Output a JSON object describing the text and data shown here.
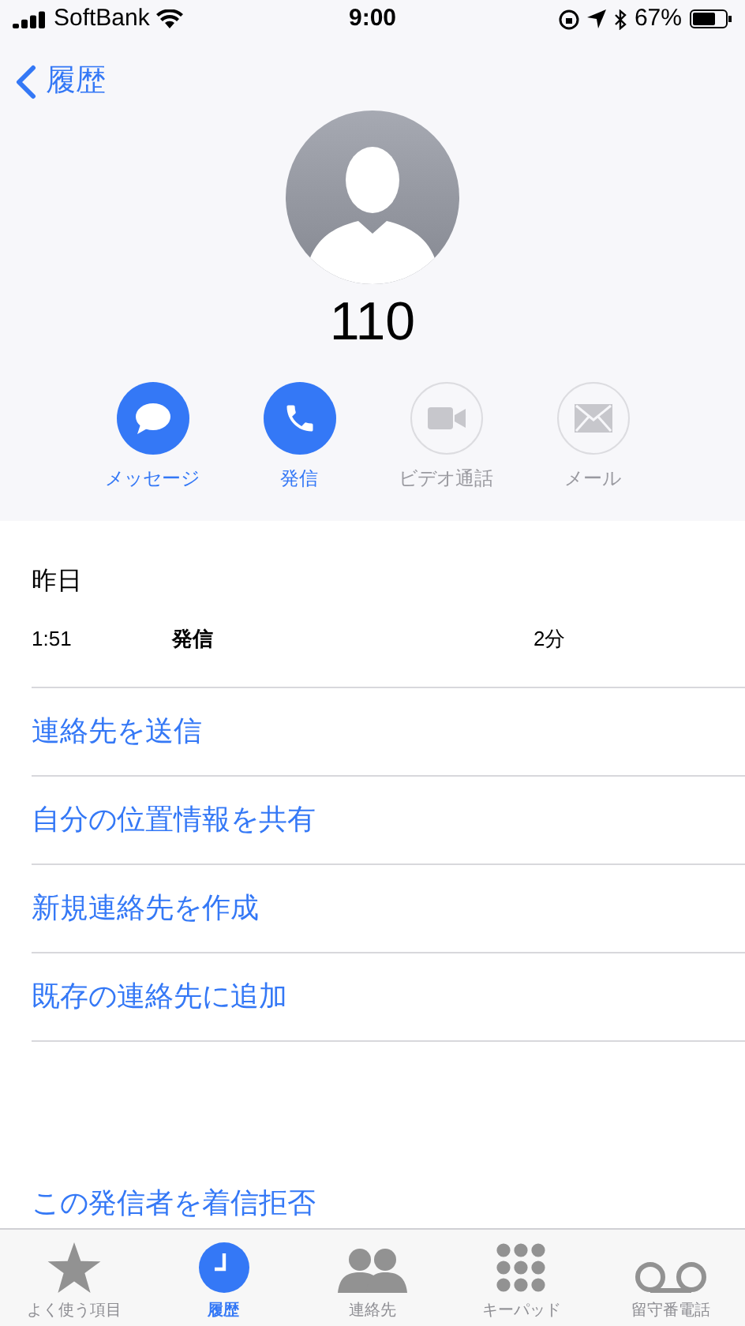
{
  "status_bar": {
    "carrier": "SoftBank",
    "time": "9:00",
    "battery": "67%"
  },
  "nav": {
    "back": "履歴"
  },
  "contact": {
    "name": "110"
  },
  "actions": [
    {
      "kind": "message",
      "label": "メッセージ",
      "disabled": false
    },
    {
      "kind": "call",
      "label": "発信",
      "disabled": false
    },
    {
      "kind": "video",
      "label": "ビデオ通話",
      "disabled": true
    },
    {
      "kind": "mail",
      "label": "メール",
      "disabled": true
    }
  ],
  "history": {
    "date": "昨日",
    "time": "1:51",
    "type": "発信",
    "duration": "2分"
  },
  "options": [
    "連絡先を送信",
    "自分の位置情報を共有",
    "新規連絡先を作成",
    "既存の連絡先に追加"
  ],
  "block": "この発信者を着信拒否",
  "tabs": [
    {
      "kind": "favorites",
      "label": "よく使う項目",
      "selected": false
    },
    {
      "kind": "recents",
      "label": "履歴",
      "selected": true
    },
    {
      "kind": "contacts",
      "label": "連絡先",
      "selected": false
    },
    {
      "kind": "keypad",
      "label": "キーパッド",
      "selected": false
    },
    {
      "kind": "voicemail",
      "label": "留守番電話",
      "selected": false
    }
  ]
}
